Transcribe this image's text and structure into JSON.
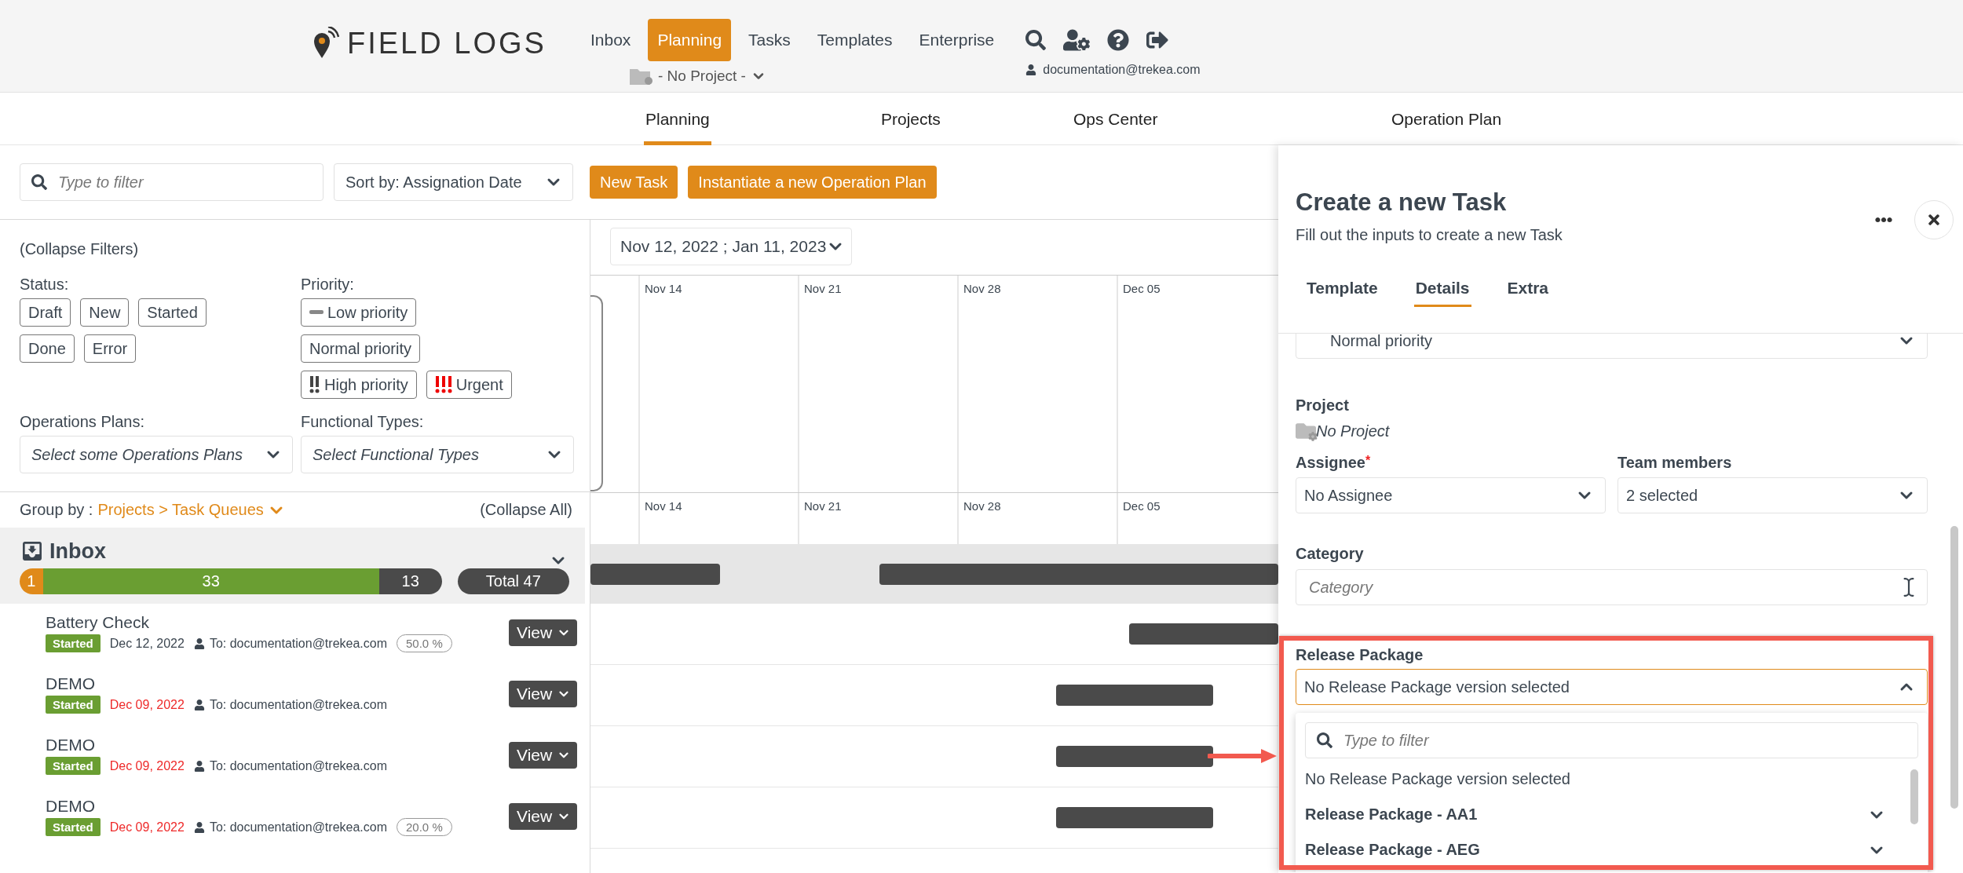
{
  "header": {
    "logo": "FIELD LOGS",
    "nav": [
      {
        "label": "Inbox",
        "selected": false
      },
      {
        "label": "Planning",
        "selected": true
      },
      {
        "label": "Tasks",
        "selected": false
      },
      {
        "label": "Templates",
        "selected": false
      },
      {
        "label": "Enterprise",
        "selected": false
      }
    ],
    "project_selector": "- No Project -",
    "user_email": "documentation@trekea.com"
  },
  "subnav": [
    {
      "label": "Planning",
      "selected": true
    },
    {
      "label": "Projects",
      "selected": false
    },
    {
      "label": "Ops Center",
      "selected": false
    },
    {
      "label": "Operation Plan",
      "selected": false
    }
  ],
  "toolbar": {
    "search": {
      "placeholder": "Type to filter"
    },
    "sort": "Sort by: Assignation Date",
    "buttons": [
      "New Task",
      "Instantiate a new Operation Plan"
    ]
  },
  "filters": {
    "collapse": "(Collapse Filters)",
    "status_label": "Status:",
    "statuses": [
      "Draft",
      "New",
      "Started",
      "Done",
      "Error"
    ],
    "priority_label": "Priority:",
    "priorities": [
      {
        "label": "Low priority",
        "kind": "low"
      },
      {
        "label": "Normal priority",
        "kind": "normal"
      },
      {
        "label": "High priority",
        "kind": "high"
      },
      {
        "label": "Urgent",
        "kind": "urgent"
      }
    ],
    "operations_plans": {
      "label": "Operations Plans:",
      "placeholder": "Select some Operations Plans"
    },
    "functional_types": {
      "label": "Functional Types:",
      "placeholder": "Select Functional Types"
    }
  },
  "grouping": {
    "label": "Group by :",
    "value": "Projects > Task Queues",
    "collapse_all": "(Collapse All)"
  },
  "group": {
    "title": "Inbox",
    "counts": [
      {
        "value": "1",
        "color": "#e08a1a"
      },
      {
        "value": "33",
        "color": "#6a9e32"
      },
      {
        "value": "13",
        "color": "#4a4a4a"
      }
    ],
    "total": "Total 47"
  },
  "tasks": [
    {
      "title": "Battery Check",
      "status": "Started",
      "date": "Dec 12, 2022",
      "overdue": false,
      "assignee": "To: documentation@trekea.com",
      "progress": "50.0 %",
      "action": "View"
    },
    {
      "title": "DEMO",
      "status": "Started",
      "date": "Dec 09, 2022",
      "overdue": true,
      "assignee": "To: documentation@trekea.com",
      "action": "View"
    },
    {
      "title": "DEMO",
      "status": "Started",
      "date": "Dec 09, 2022",
      "overdue": true,
      "assignee": "To: documentation@trekea.com",
      "action": "View"
    },
    {
      "title": "DEMO",
      "status": "Started",
      "date": "Dec 09, 2022",
      "overdue": true,
      "assignee": "To: documentation@trekea.com",
      "progress": "20.0 %",
      "action": "View"
    }
  ],
  "gantt": {
    "range": "Nov 12, 2022 ; Jan 11, 2023",
    "top_weeks": [
      "Nov 14",
      "Nov 21",
      "Nov 28",
      "Dec 05"
    ],
    "bottom_weeks": [
      "Nov 14",
      "Nov 21",
      "Nov 28",
      "Dec 05"
    ]
  },
  "panel": {
    "title": "Create a new Task",
    "subtitle": "Fill out the inputs to create a new Task",
    "tabs": [
      {
        "label": "Template",
        "selected": false
      },
      {
        "label": "Details",
        "selected": true
      },
      {
        "label": "Extra",
        "selected": false
      }
    ],
    "priority_value": "Normal priority",
    "project_label": "Project",
    "project_value": "No Project",
    "assignee": {
      "label": "Assignee",
      "required_mark": "*",
      "value": "No Assignee"
    },
    "team_members": {
      "label": "Team members",
      "value": "2 selected"
    },
    "category": {
      "label": "Category",
      "placeholder": "Category"
    },
    "release_package": {
      "label": "Release Package",
      "value": "No Release Package version selected",
      "expanded": true,
      "filter_placeholder": "Type to filter",
      "options": [
        {
          "label": "No Release Package version selected",
          "kind": "plain"
        },
        {
          "label": "Release Package - AA1",
          "kind": "group"
        },
        {
          "label": "Release Package - AEG",
          "kind": "group"
        }
      ]
    }
  }
}
